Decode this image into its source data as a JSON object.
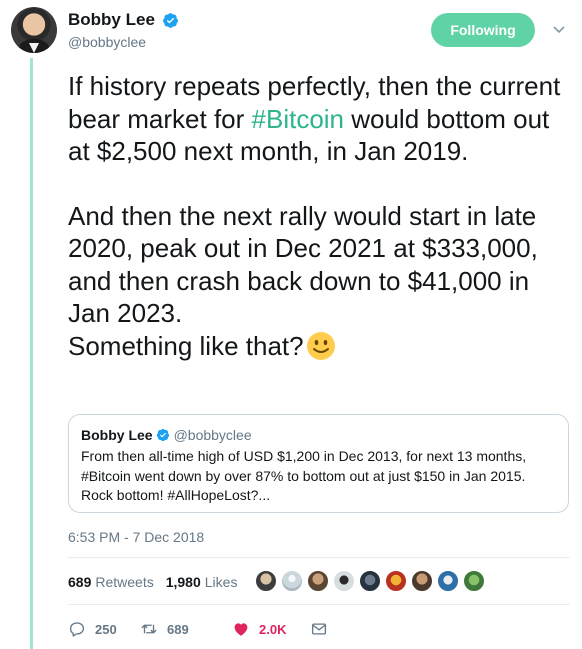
{
  "author": {
    "name": "Bobby Lee",
    "handle": "@bobbyclee"
  },
  "follow_label": "Following",
  "tweet": {
    "p1_before": "If history repeats perfectly, then the current bear market for ",
    "p1_hashtag": "#Bitcoin",
    "p1_after": " would bottom out at $2,500 next month, in Jan 2019.",
    "p2": "And then the next rally would start in late 2020, peak out in Dec 2021 at $333,000, and then crash back down to $41,000 in Jan 2023.",
    "p3": "Something like that?"
  },
  "quoted": {
    "name": "Bobby Lee",
    "handle": "@bobbyclee",
    "text": "From then all-time high of USD $1,200 in Dec 2013, for next 13 months, #Bitcoin went down by over 87% to bottom out at just $150 in Jan 2015. Rock bottom! #AllHopeLost?..."
  },
  "timestamp": "6:53 PM - 7 Dec 2018",
  "stats": {
    "retweets_count": "689",
    "retweets_label": "Retweets",
    "likes_count": "1,980",
    "likes_label": "Likes"
  },
  "actions": {
    "replies": "250",
    "retweets": "689",
    "likes": "2.0K"
  },
  "colors": {
    "accent": "#5fd3a6",
    "hashtag": "#2cb48f",
    "thread_line": "#a3e3d3",
    "like": "#e0245e",
    "verified": "#1da1f2"
  },
  "icons": [
    "verified-badge-icon",
    "chevron-down-icon",
    "smiley-emoji-icon",
    "reply-icon",
    "retweet-icon",
    "heart-icon",
    "direct-message-icon"
  ]
}
